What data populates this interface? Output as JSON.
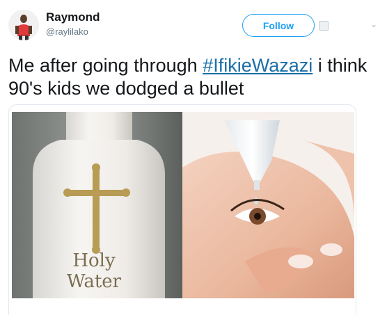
{
  "tweet": {
    "author_name": "Raymond",
    "author_handle": "@raylilako",
    "follow_label": "Follow",
    "text_before": "Me after going through ",
    "hashtag": "#IfikieWazazi",
    "text_after": " i think 90's kids we dodged a bullet"
  },
  "media": {
    "left_image": {
      "label_line1": "Holy",
      "label_line2": "Water"
    },
    "right_image": {}
  },
  "colors": {
    "accent": "#1da1f2",
    "hashtag": "#1b6fa8",
    "handle": "#657786"
  },
  "icons": {
    "caret": "chevron-down-icon",
    "follow_indicator": "follow-indicator-icon"
  }
}
